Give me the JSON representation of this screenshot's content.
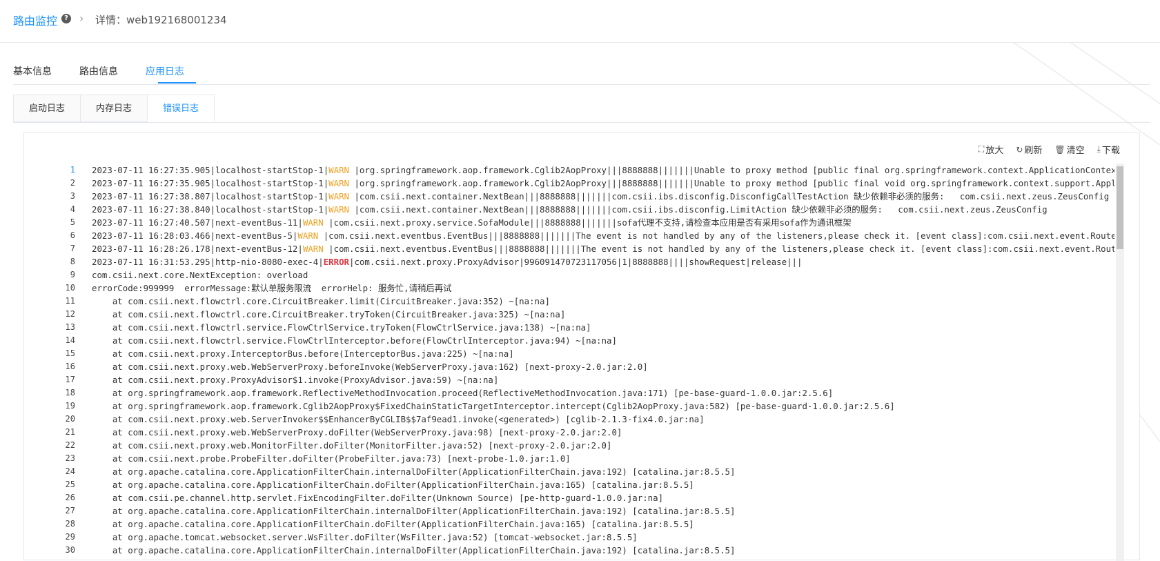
{
  "breadcrumb": {
    "root": "路由监控",
    "help_icon": "question-circle-icon",
    "separator_icon": "chevron-right-icon",
    "detail": "详情：web192168001234"
  },
  "tabs": [
    {
      "label": "基本信息",
      "active": false
    },
    {
      "label": "路由信息",
      "active": false
    },
    {
      "label": "应用日志",
      "active": true
    }
  ],
  "log_tabs": [
    {
      "label": "启动日志",
      "active": false
    },
    {
      "label": "内存日志",
      "active": false
    },
    {
      "label": "错误日志",
      "active": true
    }
  ],
  "toolbar": {
    "expand": {
      "label": "放大",
      "icon": "expand-icon"
    },
    "refresh": {
      "label": "刷新",
      "icon": "refresh-icon"
    },
    "clear": {
      "label": "清空",
      "icon": "trash-icon"
    },
    "download": {
      "label": "下载",
      "icon": "download-icon"
    }
  },
  "colors": {
    "accent": "#1890ff",
    "warn": "#f0a020",
    "error": "#d9363e"
  },
  "log_lines": [
    {
      "n": "1",
      "pre": "2023-07-11 16:27:35.905|localhost-startStop-1|",
      "level": "WARN ",
      "lv": "warn",
      "post": "|org.springframework.aop.framework.Cglib2AopProxy|||8888888|||||||Unable to proxy method [public final org.springframework.context.ApplicationContext"
    },
    {
      "n": "2",
      "pre": "2023-07-11 16:27:35.905|localhost-startStop-1|",
      "level": "WARN ",
      "lv": "warn",
      "post": "|org.springframework.aop.framework.Cglib2AopProxy|||8888888|||||||Unable to proxy method [public final void org.springframework.context.support.Applic"
    },
    {
      "n": "3",
      "pre": "2023-07-11 16:27:38.807|localhost-startStop-1|",
      "level": "WARN ",
      "lv": "warn",
      "post": "|com.csii.next.container.NextBean|||8888888|||||||com.csii.ibs.disconfig.DisconfigCallTestAction 缺少依赖非必须的服务:   com.csii.next.zeus.ZeusConfig"
    },
    {
      "n": "4",
      "pre": "2023-07-11 16:27:38.840|localhost-startStop-1|",
      "level": "WARN ",
      "lv": "warn",
      "post": "|com.csii.next.container.NextBean|||8888888|||||||com.csii.ibs.disconfig.LimitAction 缺少依赖非必须的服务:   com.csii.next.zeus.ZeusConfig"
    },
    {
      "n": "5",
      "pre": "2023-07-11 16:27:40.507|next-eventBus-11|",
      "level": "WARN ",
      "lv": "warn",
      "post": "|com.csii.next.proxy.service.SofaModule|||8888888|||||||sofa代理不支持,请检查本应用是否有采用sofa作为通讯框架"
    },
    {
      "n": "6",
      "pre": "2023-07-11 16:28:03.466|next-eventBus-5|",
      "level": "WARN ",
      "lv": "warn",
      "post": "|com.csii.next.eventbus.EventBus|||8888888|||||||The event is not handled by any of the listeners,please check it. [event class]:com.csii.next.event.RouteVe"
    },
    {
      "n": "7",
      "pre": "2023-07-11 16:28:26.178|next-eventBus-12|",
      "level": "WARN ",
      "lv": "warn",
      "post": "|com.csii.next.eventbus.EventBus|||8888888|||||||The event is not handled by any of the listeners,please check it. [event class]:com.csii.next.event.RouteV"
    },
    {
      "n": "8",
      "pre": "2023-07-11 16:31:53.295|http-nio-8080-exec-4|",
      "level": "ERROR",
      "lv": "error",
      "post": "|com.csii.next.proxy.ProxyAdvisor|996091470723117056|1|8888888||||showRequest|release|||"
    },
    {
      "n": "9",
      "pre": "com.csii.next.core.NextException: overload",
      "level": "",
      "lv": "",
      "post": ""
    },
    {
      "n": "10",
      "pre": "errorCode:999999  errorMessage:默认单服务限流  errorHelp: 服务忙,请稍后再试",
      "level": "",
      "lv": "",
      "post": ""
    },
    {
      "n": "11",
      "pre": "    at com.csii.next.flowctrl.core.CircuitBreaker.limit(CircuitBreaker.java:352) ~[na:na]",
      "level": "",
      "lv": "",
      "post": ""
    },
    {
      "n": "12",
      "pre": "    at com.csii.next.flowctrl.core.CircuitBreaker.tryToken(CircuitBreaker.java:325) ~[na:na]",
      "level": "",
      "lv": "",
      "post": ""
    },
    {
      "n": "13",
      "pre": "    at com.csii.next.flowctrl.service.FlowCtrlService.tryToken(FlowCtrlService.java:138) ~[na:na]",
      "level": "",
      "lv": "",
      "post": ""
    },
    {
      "n": "14",
      "pre": "    at com.csii.next.flowctrl.service.FlowCtrlInterceptor.before(FlowCtrlInterceptor.java:94) ~[na:na]",
      "level": "",
      "lv": "",
      "post": ""
    },
    {
      "n": "15",
      "pre": "    at com.csii.next.proxy.InterceptorBus.before(InterceptorBus.java:225) ~[na:na]",
      "level": "",
      "lv": "",
      "post": ""
    },
    {
      "n": "16",
      "pre": "    at com.csii.next.proxy.web.WebServerProxy.beforeInvoke(WebServerProxy.java:162) [next-proxy-2.0.jar:2.0]",
      "level": "",
      "lv": "",
      "post": ""
    },
    {
      "n": "17",
      "pre": "    at com.csii.next.proxy.ProxyAdvisor$1.invoke(ProxyAdvisor.java:59) ~[na:na]",
      "level": "",
      "lv": "",
      "post": ""
    },
    {
      "n": "18",
      "pre": "    at org.springframework.aop.framework.ReflectiveMethodInvocation.proceed(ReflectiveMethodInvocation.java:171) [pe-base-guard-1.0.0.jar:2.5.6]",
      "level": "",
      "lv": "",
      "post": ""
    },
    {
      "n": "19",
      "pre": "    at org.springframework.aop.framework.Cglib2AopProxy$FixedChainStaticTargetInterceptor.intercept(Cglib2AopProxy.java:582) [pe-base-guard-1.0.0.jar:2.5.6]",
      "level": "",
      "lv": "",
      "post": ""
    },
    {
      "n": "20",
      "pre": "    at com.csii.next.proxy.web.ServerInvoker$$EnhancerByCGLIB$$7af9ead1.invoke(<generated>) [cglib-2.1.3-fix4.0.jar:na]",
      "level": "",
      "lv": "",
      "post": ""
    },
    {
      "n": "21",
      "pre": "    at com.csii.next.proxy.web.WebServerProxy.doFilter(WebServerProxy.java:98) [next-proxy-2.0.jar:2.0]",
      "level": "",
      "lv": "",
      "post": ""
    },
    {
      "n": "22",
      "pre": "    at com.csii.next.proxy.web.MonitorFilter.doFilter(MonitorFilter.java:52) [next-proxy-2.0.jar:2.0]",
      "level": "",
      "lv": "",
      "post": ""
    },
    {
      "n": "23",
      "pre": "    at com.csii.next.probe.ProbeFilter.doFilter(ProbeFilter.java:73) [next-probe-1.0.jar:1.0]",
      "level": "",
      "lv": "",
      "post": ""
    },
    {
      "n": "24",
      "pre": "    at org.apache.catalina.core.ApplicationFilterChain.internalDoFilter(ApplicationFilterChain.java:192) [catalina.jar:8.5.5]",
      "level": "",
      "lv": "",
      "post": ""
    },
    {
      "n": "25",
      "pre": "    at org.apache.catalina.core.ApplicationFilterChain.doFilter(ApplicationFilterChain.java:165) [catalina.jar:8.5.5]",
      "level": "",
      "lv": "",
      "post": ""
    },
    {
      "n": "26",
      "pre": "    at com.csii.pe.channel.http.servlet.FixEncodingFilter.doFilter(Unknown Source) [pe-http-guard-1.0.0.jar:na]",
      "level": "",
      "lv": "",
      "post": ""
    },
    {
      "n": "27",
      "pre": "    at org.apache.catalina.core.ApplicationFilterChain.internalDoFilter(ApplicationFilterChain.java:192) [catalina.jar:8.5.5]",
      "level": "",
      "lv": "",
      "post": ""
    },
    {
      "n": "28",
      "pre": "    at org.apache.catalina.core.ApplicationFilterChain.doFilter(ApplicationFilterChain.java:165) [catalina.jar:8.5.5]",
      "level": "",
      "lv": "",
      "post": ""
    },
    {
      "n": "29",
      "pre": "    at org.apache.tomcat.websocket.server.WsFilter.doFilter(WsFilter.java:52) [tomcat-websocket.jar:8.5.5]",
      "level": "",
      "lv": "",
      "post": ""
    },
    {
      "n": "30",
      "pre": "    at org.apache.catalina.core.ApplicationFilterChain.internalDoFilter(ApplicationFilterChain.java:192) [catalina.jar:8.5.5]",
      "level": "",
      "lv": "",
      "post": ""
    }
  ]
}
